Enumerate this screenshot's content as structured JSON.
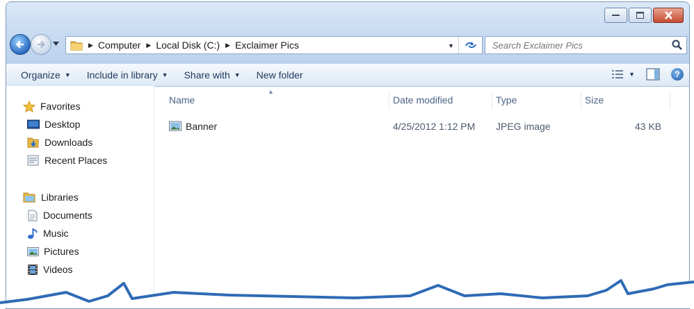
{
  "address": {
    "crumbs": [
      "Computer",
      "Local Disk (C:)",
      "Exclaimer Pics"
    ]
  },
  "search": {
    "placeholder": "Search Exclaimer Pics"
  },
  "toolbar": {
    "organize": "Organize",
    "include_in_library": "Include in library",
    "share_with": "Share with",
    "new_folder": "New folder"
  },
  "nav": {
    "favorites": {
      "label": "Favorites",
      "items": [
        "Desktop",
        "Downloads",
        "Recent Places"
      ]
    },
    "libraries": {
      "label": "Libraries",
      "items": [
        "Documents",
        "Music",
        "Pictures",
        "Videos"
      ]
    }
  },
  "columns": {
    "name": "Name",
    "date_modified": "Date modified",
    "type": "Type",
    "size": "Size"
  },
  "files": [
    {
      "name": "Banner",
      "date_modified": "4/25/2012 1:12 PM",
      "type": "JPEG image",
      "size": "43 KB",
      "icon": "image-file-icon"
    }
  ],
  "colors": {
    "titlebar": "#c6daf1",
    "close_button": "#c74b30",
    "torn_edge": "#2f6ab5"
  }
}
